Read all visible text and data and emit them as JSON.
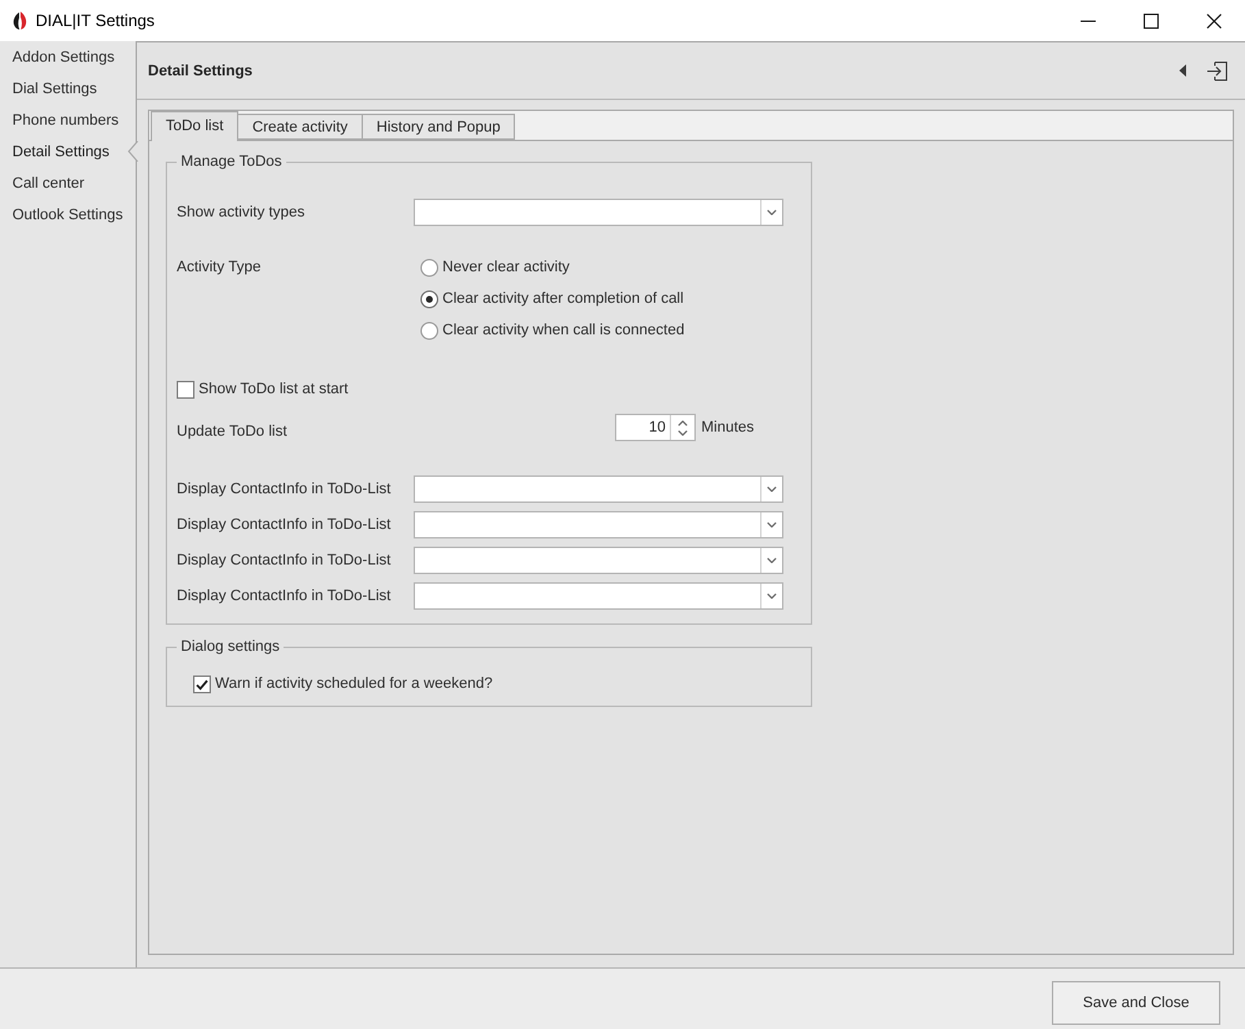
{
  "window": {
    "title": "DIAL|IT Settings"
  },
  "sidebar": {
    "items": [
      {
        "label": "Addon Settings",
        "selected": false
      },
      {
        "label": "Dial Settings",
        "selected": false
      },
      {
        "label": "Phone numbers",
        "selected": false
      },
      {
        "label": "Detail Settings",
        "selected": true
      },
      {
        "label": "Call center",
        "selected": false
      },
      {
        "label": "Outlook Settings",
        "selected": false
      }
    ]
  },
  "header": {
    "title": "Detail Settings"
  },
  "tabs": [
    {
      "label": "ToDo list",
      "selected": true
    },
    {
      "label": "Create activity",
      "selected": false
    },
    {
      "label": "History and Popup",
      "selected": false
    }
  ],
  "manage_todos": {
    "title": "Manage ToDos",
    "show_activity_types": {
      "label": "Show activity types"
    },
    "activity_type": {
      "label": "Activity Type",
      "options": [
        {
          "label": "Never clear activity",
          "selected": false
        },
        {
          "label": "Clear activity after completion of call",
          "selected": true
        },
        {
          "label": "Clear activity when call is connected",
          "selected": false
        }
      ]
    },
    "show_todo_list_at_start": {
      "label": "Show ToDo list at start",
      "checked": false
    },
    "update_todo_list": {
      "label": "Update ToDo list",
      "value": "10",
      "unit": "Minutes"
    },
    "contact_info_fields": [
      {
        "label": "Display ContactInfo in ToDo-List"
      },
      {
        "label": "Display ContactInfo in ToDo-List"
      },
      {
        "label": "Display ContactInfo in ToDo-List"
      },
      {
        "label": "Display ContactInfo in ToDo-List"
      }
    ]
  },
  "dialog_settings": {
    "title": "Dialog settings",
    "warn_weekend": {
      "label": "Warn if activity scheduled for a weekend?",
      "checked": true
    }
  },
  "buttons": [
    "Save and Close"
  ]
}
